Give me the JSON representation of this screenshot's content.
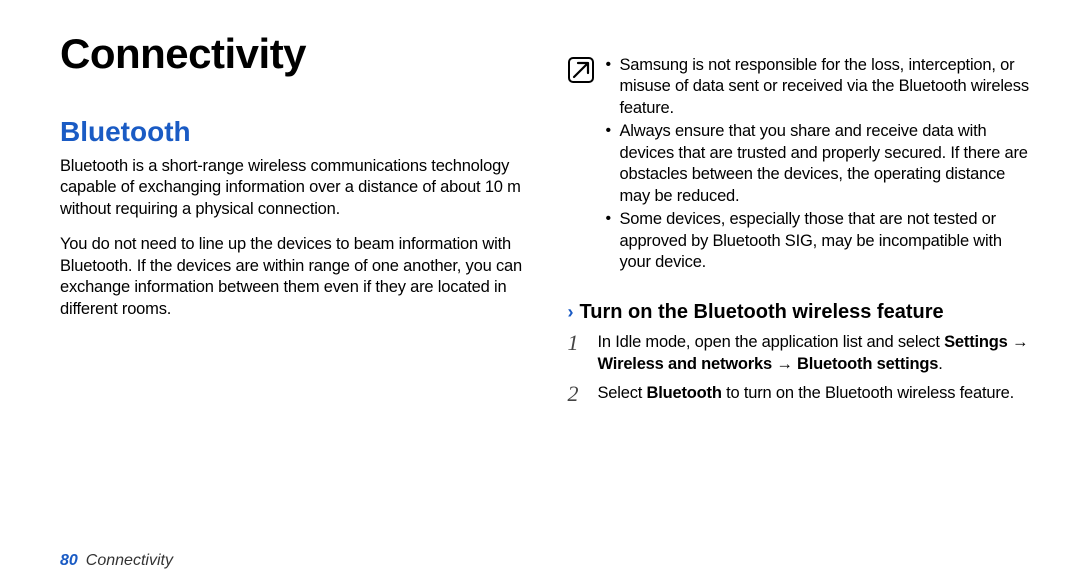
{
  "title": "Connectivity",
  "section": {
    "heading": "Bluetooth",
    "p1": "Bluetooth is a short-range wireless communications technology capable of exchanging information over a distance of about 10 m without requiring a physical connection.",
    "p2": "You do not need to line up the devices to beam information with Bluetooth. If the devices are within range of one another, you can exchange information between them even if they are located in different rooms."
  },
  "note": {
    "items": [
      "Samsung is not responsible for the loss, interception, or misuse of data sent or received via the Bluetooth wireless feature.",
      "Always ensure that you share and receive data with devices that are trusted and properly secured. If there are obstacles between the devices, the operating distance may be reduced.",
      "Some devices, especially those that are not tested or approved by Bluetooth SIG, may be incompatible with your device."
    ]
  },
  "subsection": {
    "heading": "Turn on the Bluetooth wireless feature",
    "steps": [
      {
        "num": "1",
        "pre": "In Idle mode, open the application list and select ",
        "bold": "Settings → Wireless and networks → Bluetooth settings",
        "post": "."
      },
      {
        "num": "2",
        "pre": "Select ",
        "bold": "Bluetooth",
        "post": " to turn on the Bluetooth wireless feature."
      }
    ]
  },
  "footer": {
    "page": "80",
    "chapter": "Connectivity"
  }
}
